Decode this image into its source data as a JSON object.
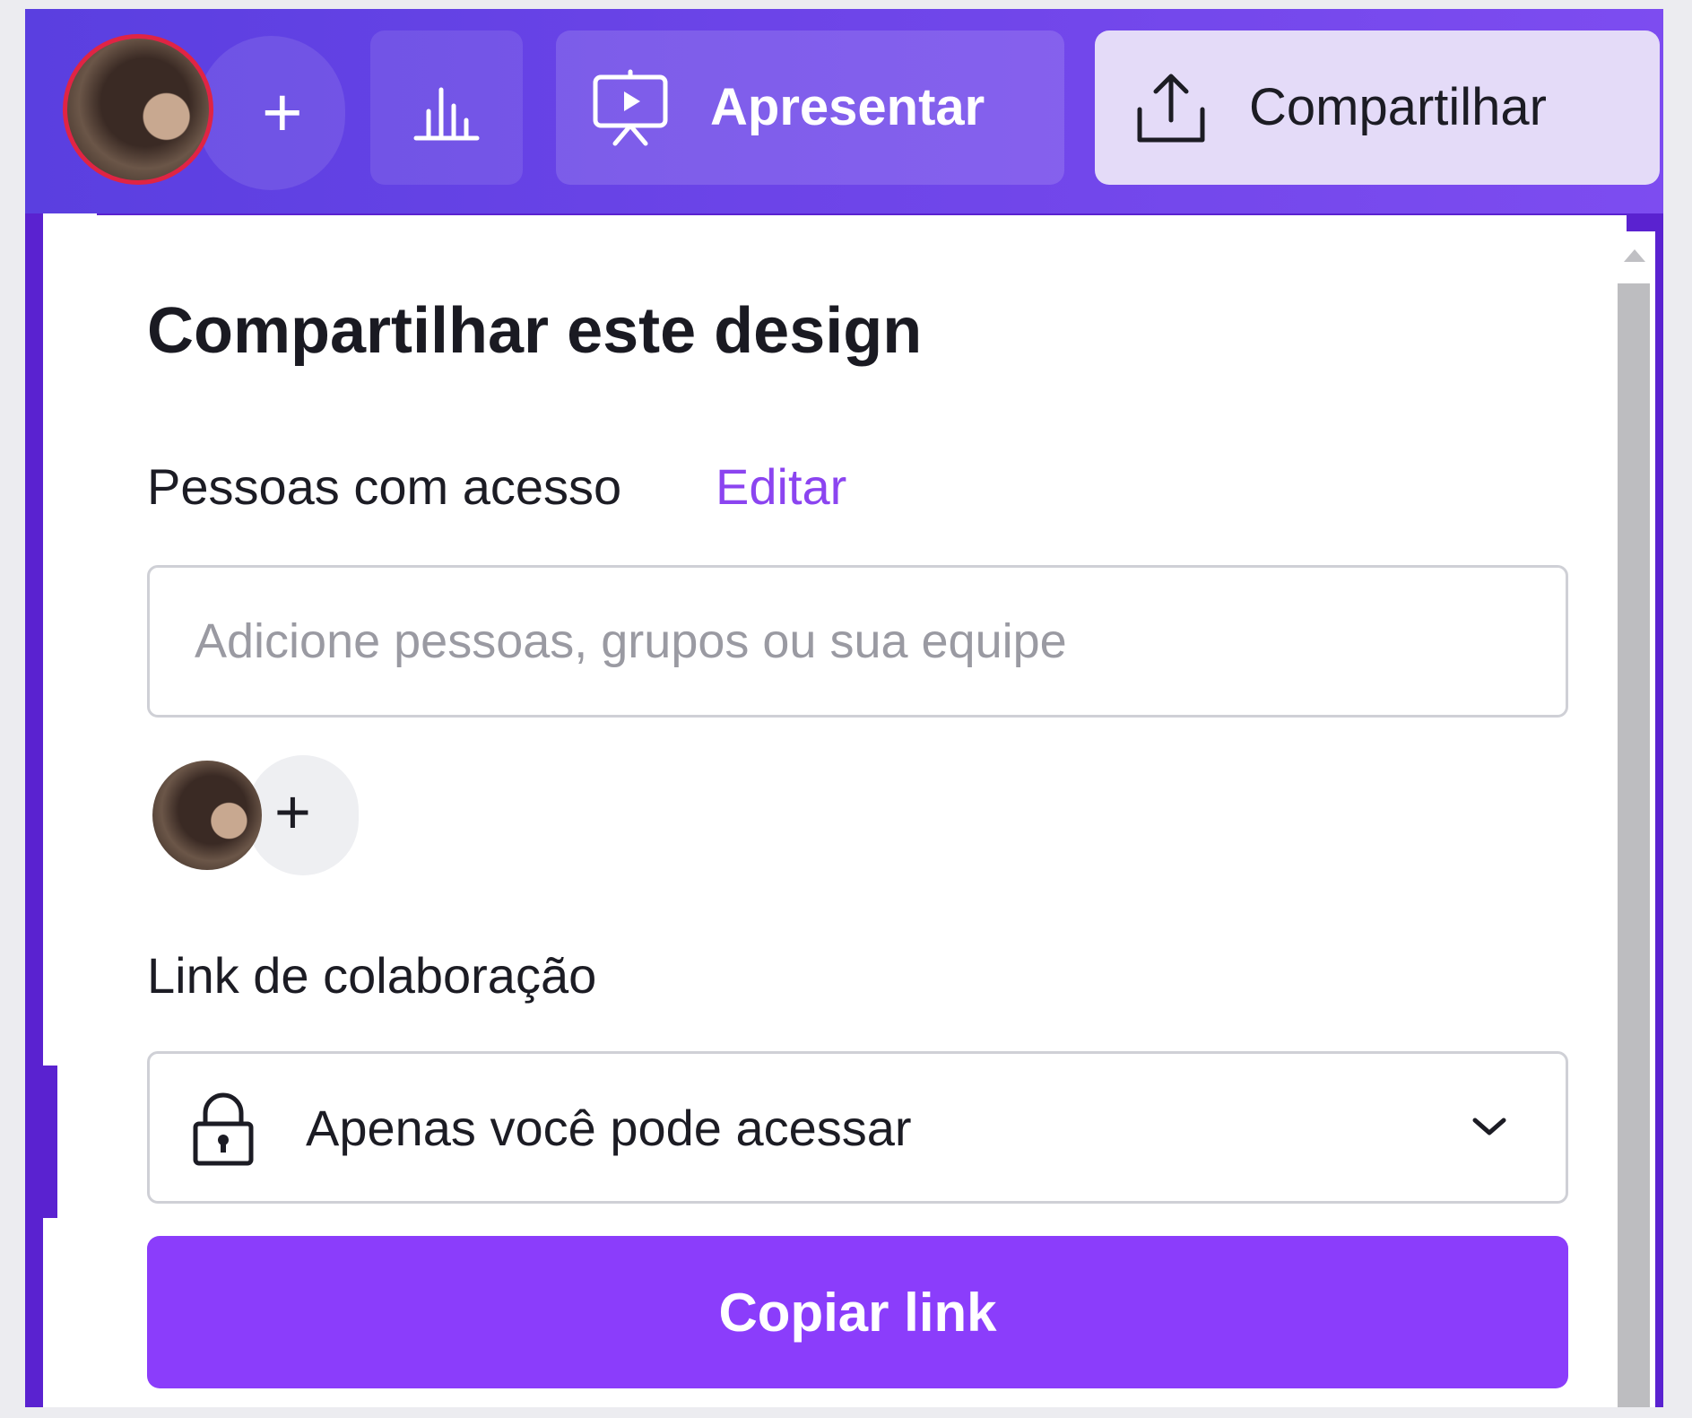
{
  "header": {
    "add_collaborator_label": "+",
    "present_label": "Apresentar",
    "share_label": "Compartilhar"
  },
  "share_panel": {
    "title": "Compartilhar este design",
    "people_access_label": "Pessoas com acesso",
    "edit_label": "Editar",
    "people_input_placeholder": "Adicione pessoas, grupos ou sua equipe",
    "add_person_label": "+",
    "collab_link_label": "Link de colaboração",
    "access_option": "Apenas você pode acessar",
    "copy_link_label": "Copiar link"
  },
  "icons": {
    "present": "presentation-screen-icon",
    "share": "upload-share-icon",
    "insights": "bar-chart-icon",
    "lock": "lock-icon",
    "chevron": "chevron-down-icon"
  },
  "colors": {
    "header_gradient_start": "#5a3fe0",
    "header_gradient_end": "#7d4cf0",
    "accent": "#8b3dfb",
    "link": "#8b44f0",
    "share_button_bg": "#e4dbf8",
    "avatar_ring": "#e02444"
  }
}
